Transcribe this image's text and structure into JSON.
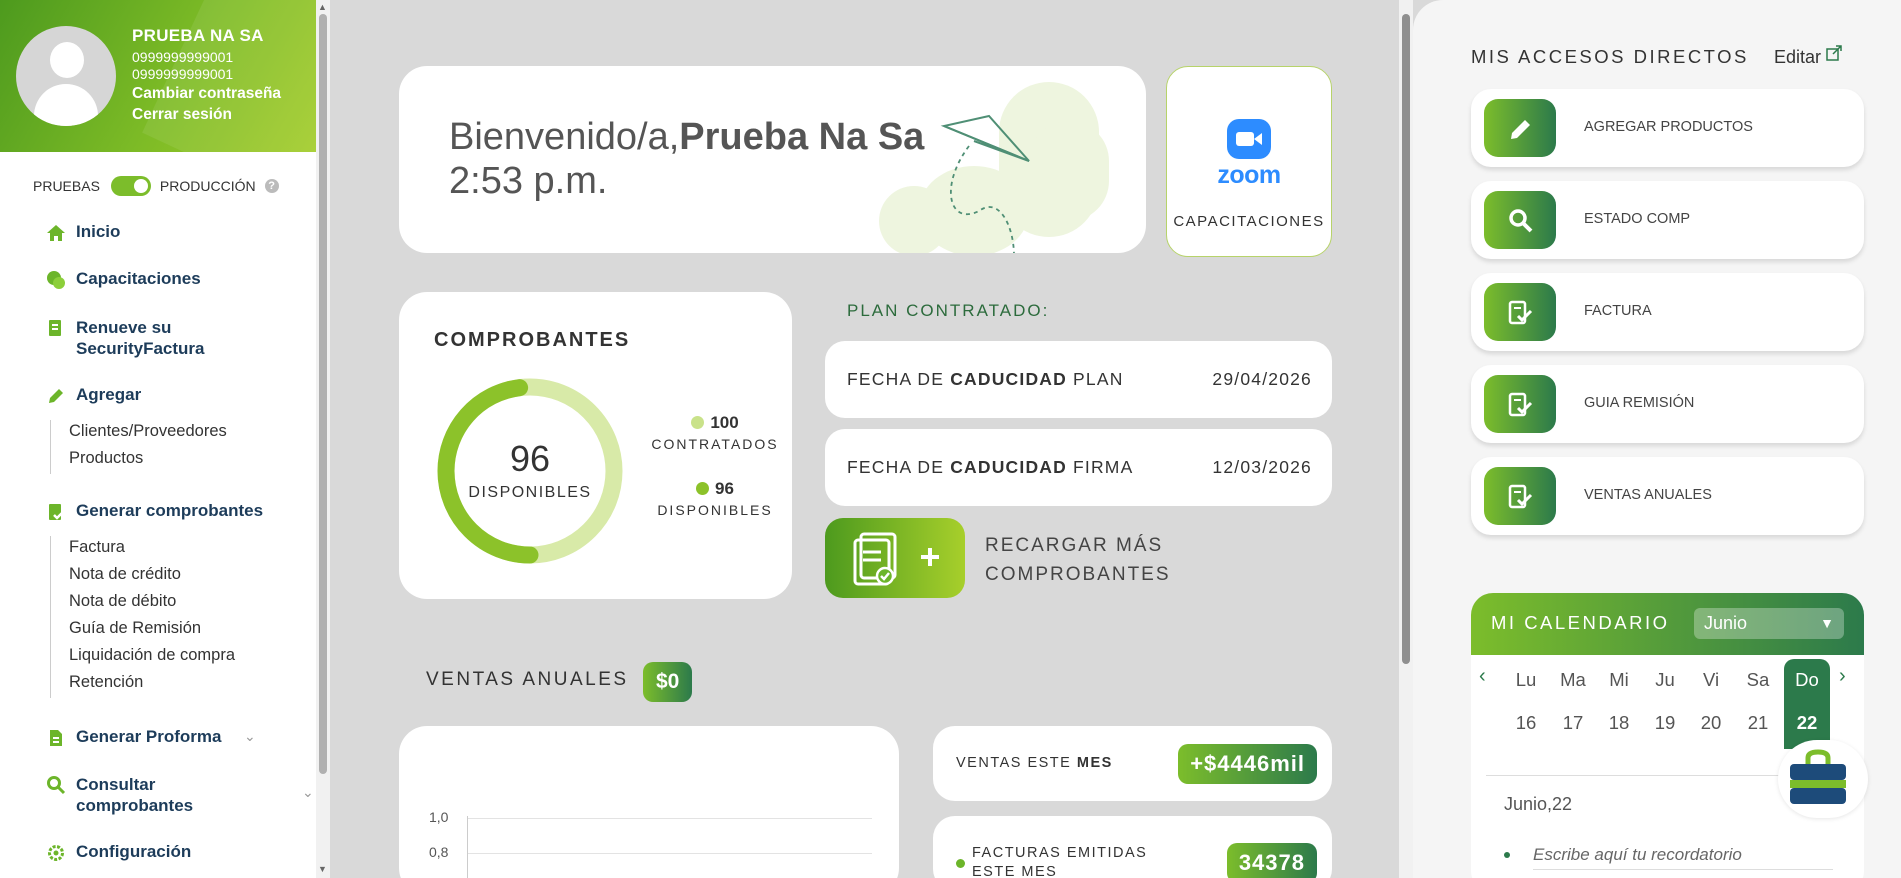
{
  "colors": {
    "brand_green": "#7cbd2b",
    "dark_green": "#2c7a4b",
    "navy": "#1d3c5a",
    "zoom_blue": "#2d8cff"
  },
  "profile": {
    "name": "PRUEBA NA SA",
    "id_1": "0999999999001",
    "id_2": "0999999999001",
    "change_password": "Cambiar contraseña",
    "logout": "Cerrar sesión"
  },
  "env_toggle": {
    "left_label": "PRUEBAS",
    "right_label": "PRODUCCIÓN",
    "help": "?"
  },
  "nav": {
    "inicio": "Inicio",
    "capacitaciones": "Capacitaciones",
    "renueve_1": "Renueve su",
    "renueve_2": "SecurityFactura",
    "agregar": "Agregar",
    "agregar_sub": [
      "Clientes/Proveedores",
      "Productos"
    ],
    "generar": "Generar comprobantes",
    "generar_sub": [
      "Factura",
      "Nota de crédito",
      "Nota de débito",
      "Guía de Remisión",
      "Liquidación de compra",
      "Retención"
    ],
    "proforma": "Generar Proforma",
    "consultar_1": "Consultar",
    "consultar_2": "comprobantes",
    "config": "Configuración"
  },
  "welcome": {
    "greeting": "Bienvenido/a,",
    "user": "Prueba Na Sa",
    "time": "2:53 p.m."
  },
  "zoom": {
    "brand": "zoom",
    "label": "CAPACITACIONES"
  },
  "comprobantes": {
    "title": "COMPROBANTES",
    "available": "96",
    "available_label": "DISPONIBLES",
    "contracted_value": "100",
    "contracted_label": "CONTRATADOS",
    "available_value": "96",
    "available_legend": "DISPONIBLES",
    "fraction_available": 0.96
  },
  "plan": {
    "title": "PLAN CONTRATADO:",
    "row1_prefix": "FECHA DE ",
    "row1_bold": "CADUCIDAD",
    "row1_suffix": " PLAN",
    "row1_value": "29/04/2026",
    "row2_prefix": "FECHA DE ",
    "row2_bold": "CADUCIDAD",
    "row2_suffix": " FIRMA",
    "row2_value": "12/03/2026",
    "recharge_1": "RECARGAR MÁS",
    "recharge_2": "COMPROBANTES"
  },
  "sales": {
    "title": "VENTAS ANUALES",
    "total": "$0",
    "ticks": [
      "1,0",
      "0,8"
    ],
    "month_label_prefix": "VENTAS ESTE ",
    "month_label_bold": "MES",
    "month_value": "+$4446mil",
    "invoices_label_1": "FACTURAS EMITIDAS",
    "invoices_label_2": "ESTE MES",
    "invoices_value": "34378"
  },
  "shortcuts": {
    "title": "MIS ACCESOS DIRECTOS",
    "edit": "Editar",
    "items": [
      {
        "label": "AGREGAR PRODUCTOS",
        "icon": "pencil-icon"
      },
      {
        "label": "ESTADO COMP",
        "icon": "search-icon"
      },
      {
        "label": "FACTURA",
        "icon": "document-check-icon"
      },
      {
        "label": "GUIA REMISIÓN",
        "icon": "document-check-icon"
      },
      {
        "label": "VENTAS ANUALES",
        "icon": "document-check-icon"
      }
    ]
  },
  "calendar": {
    "title": "MI CALENDARIO",
    "month": "Junio",
    "prev": "‹",
    "next": "›",
    "days": [
      "Lu",
      "Ma",
      "Mi",
      "Ju",
      "Vi",
      "Sa",
      "Do"
    ],
    "dates": [
      "16",
      "17",
      "18",
      "19",
      "20",
      "21",
      "22"
    ],
    "selected": "Junio,22",
    "reminder_placeholder": "Escribe aquí tu recordatorio"
  }
}
